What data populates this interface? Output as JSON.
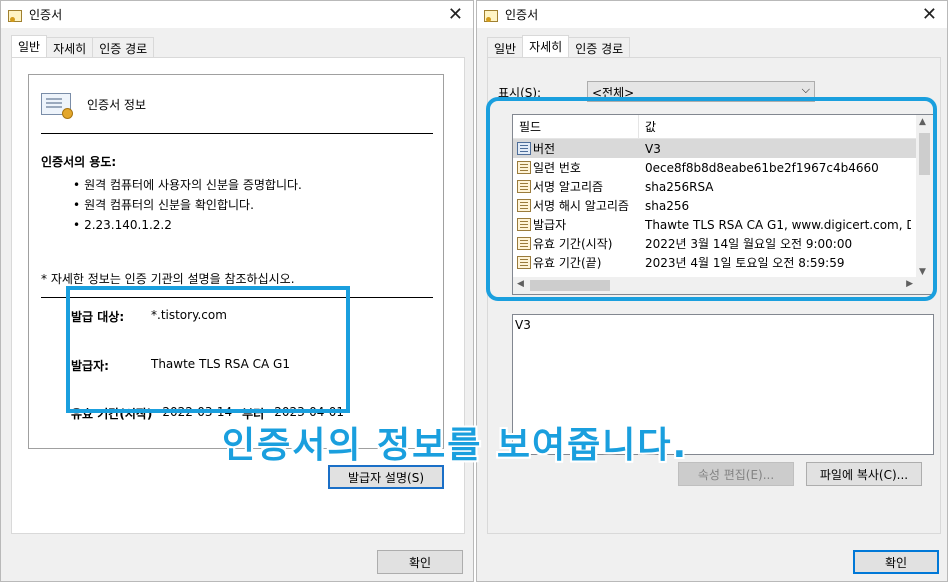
{
  "left_window": {
    "title": "인증서",
    "tabs": [
      "일반",
      "자세히",
      "인증 경로"
    ],
    "active_tab": 0,
    "cert_info_title": "인증서 정보",
    "purpose_title": "인증서의 용도:",
    "purposes": [
      "원격 컴퓨터에 사용자의 신분을 증명합니다.",
      "원격 컴퓨터의 신분을 확인합니다.",
      "2.23.140.1.2.2"
    ],
    "note": "* 자세한 정보는 인증 기관의 설명을 참조하십시오.",
    "issued_to_label": "발급 대상:",
    "issued_to_value": "*.tistory.com",
    "issuer_label": "발급자:",
    "issuer_value": "Thawte TLS RSA CA G1",
    "valid_label": "유효 기간(시작)",
    "valid_from": "2022-03-14",
    "valid_to_label": "부터",
    "valid_to": "2023-04-01",
    "issuer_statement_button": "발급자 설명(S)",
    "ok_button": "확인"
  },
  "right_window": {
    "title": "인증서",
    "tabs": [
      "일반",
      "자세히",
      "인증 경로"
    ],
    "active_tab": 1,
    "show_label": "표시(S):",
    "show_value": "<전체>",
    "columns": [
      "필드",
      "값"
    ],
    "rows": [
      {
        "field": "버전",
        "value": "V3",
        "icon": "blue"
      },
      {
        "field": "일련 번호",
        "value": "0ece8f8b8d8eabe61be2f1967c4b4660",
        "icon": "gold"
      },
      {
        "field": "서명 알고리즘",
        "value": "sha256RSA",
        "icon": "gold"
      },
      {
        "field": "서명 해시 알고리즘",
        "value": "sha256",
        "icon": "gold"
      },
      {
        "field": "발급자",
        "value": "Thawte TLS RSA CA G1, www.digicert.com, DigiCe",
        "icon": "gold"
      },
      {
        "field": "유효 기간(시작)",
        "value": "2022년 3월 14일 월요일 오전 9:00:00",
        "icon": "gold"
      },
      {
        "field": "유효 기간(끝)",
        "value": "2023년 4월 1일 토요일 오전 8:59:59",
        "icon": "gold"
      }
    ],
    "detail_value": "V3",
    "edit_props_button": "속성 편집(E)...",
    "copy_file_button": "파일에 복사(C)...",
    "ok_button": "확인"
  },
  "overlay_caption": "인증서의 정보를 보여줍니다.",
  "colors": {
    "highlight": "#1a9fde",
    "dialog_bg": "#f0f0f0",
    "primary_border": "#0078d7"
  }
}
